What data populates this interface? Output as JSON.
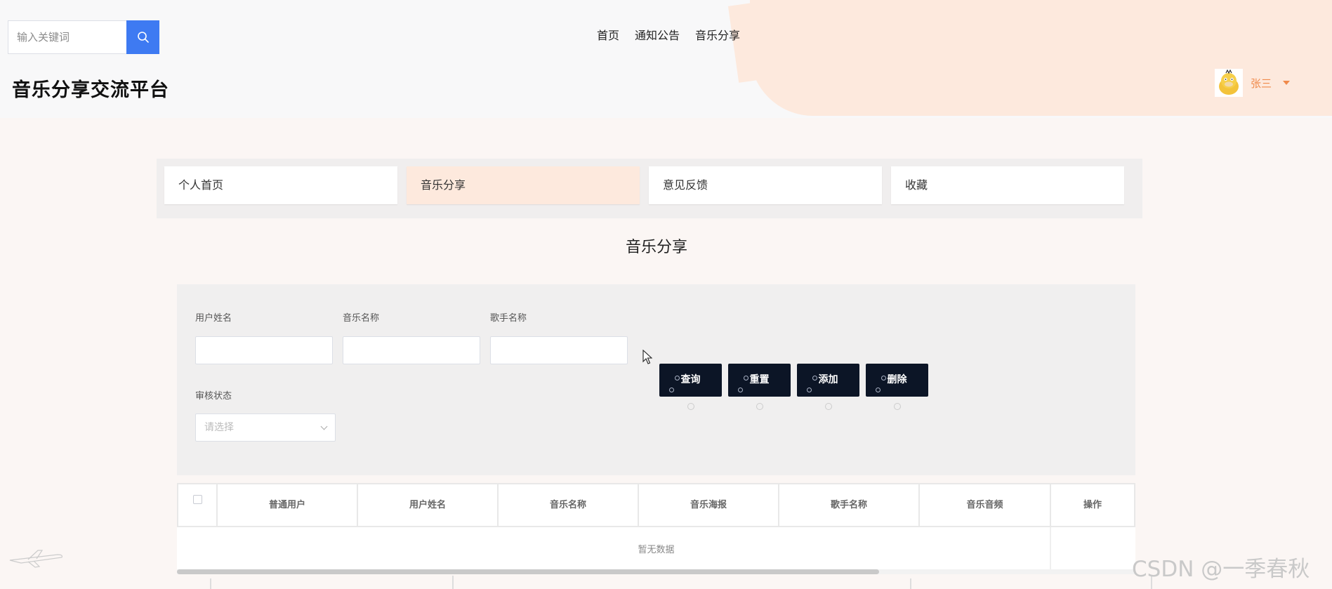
{
  "search": {
    "placeholder": "输入关键词"
  },
  "top_nav": {
    "items": [
      "首页",
      "通知公告",
      "音乐分享"
    ]
  },
  "site_title": "音乐分享交流平台",
  "user": {
    "name": "张三"
  },
  "tabs": [
    {
      "label": "个人首页",
      "active": false
    },
    {
      "label": "音乐分享",
      "active": true
    },
    {
      "label": "意见反馈",
      "active": false
    },
    {
      "label": "收藏",
      "active": false
    }
  ],
  "section_title": "音乐分享",
  "filters": {
    "user_name_label": "用户姓名",
    "music_name_label": "音乐名称",
    "singer_name_label": "歌手名称",
    "review_status_label": "审核状态",
    "review_status_placeholder": "请选择"
  },
  "buttons": {
    "query": "查询",
    "reset": "重置",
    "add": "添加",
    "delete": "删除"
  },
  "table": {
    "columns": [
      "普通用户",
      "用户姓名",
      "音乐名称",
      "音乐海报",
      "歌手名称",
      "音乐音频",
      "操作"
    ],
    "empty_text": "暂无数据"
  },
  "watermark": "CSDN @一季春秋",
  "colors": {
    "accent": "#3e7af2",
    "highlight": "#fde9dd",
    "button_dark": "#0c1526",
    "user_name": "#f08a4b"
  }
}
